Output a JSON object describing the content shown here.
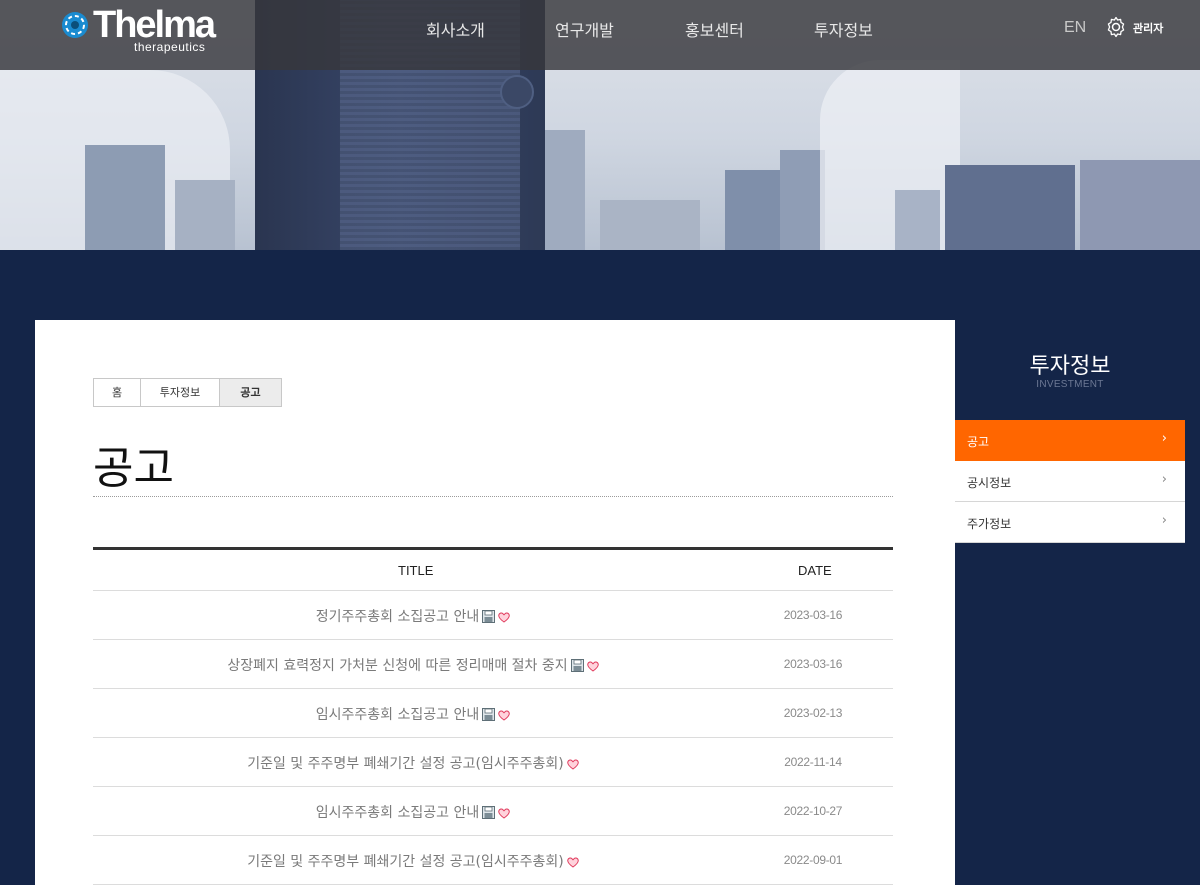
{
  "header": {
    "logo_word": "Thelma",
    "logo_sub": "therapeutics",
    "nav": [
      "회사소개",
      "연구개발",
      "홍보센터",
      "투자정보"
    ],
    "lang": "EN",
    "admin_label": "관리자"
  },
  "breadcrumb": [
    "홈",
    "투자정보",
    "공고"
  ],
  "page_title": "공고",
  "table": {
    "headers": {
      "title": "TITLE",
      "date": "DATE"
    },
    "rows": [
      {
        "title": "정기주주총회 소집공고 안내",
        "date": "2023-03-16",
        "file": true,
        "heart": true
      },
      {
        "title": "상장폐지 효력정지 가처분 신청에 따른 정리매매 절차 중지",
        "date": "2023-03-16",
        "file": true,
        "heart": true
      },
      {
        "title": "임시주주총회 소집공고 안내",
        "date": "2023-02-13",
        "file": true,
        "heart": true
      },
      {
        "title": "기준일 및 주주명부 폐쇄기간 설정 공고(임시주주총회)",
        "date": "2022-11-14",
        "file": false,
        "heart": true
      },
      {
        "title": "임시주주총회 소집공고 안내",
        "date": "2022-10-27",
        "file": true,
        "heart": true
      },
      {
        "title": "기준일 및 주주명부 폐쇄기간 설정 공고(임시주주총회)",
        "date": "2022-09-01",
        "file": false,
        "heart": true
      }
    ]
  },
  "sidebar": {
    "title": "투자정보",
    "subtitle": "INVESTMENT",
    "items": [
      {
        "label": "공고",
        "active": true
      },
      {
        "label": "공시정보",
        "active": false
      },
      {
        "label": "주가정보",
        "active": false
      }
    ],
    "arrow": "›"
  },
  "colors": {
    "accent": "#ff6600",
    "navy": "#142548"
  }
}
